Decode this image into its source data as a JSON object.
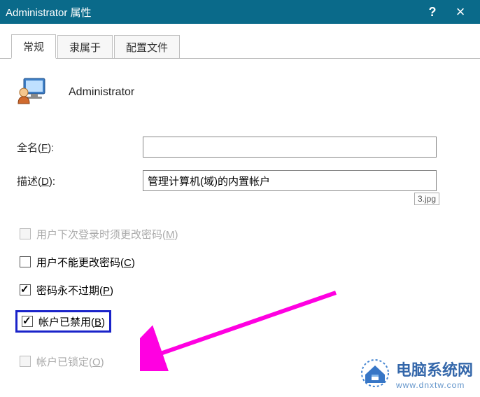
{
  "titlebar": {
    "title": "Administrator 属性"
  },
  "tabs": {
    "t0": "常规",
    "t1": "隶属于",
    "t2": "配置文件"
  },
  "account": {
    "name": "Administrator"
  },
  "labels": {
    "fullname_pre": "全名(",
    "fullname_u": "F",
    "fullname_post": "):",
    "desc_pre": "描述(",
    "desc_u": "D",
    "desc_post": "):"
  },
  "fields": {
    "fullname": "",
    "description": "管理计算机(域)的内置帐户"
  },
  "img_tag": "3.jpg",
  "checkboxes": {
    "mustchange_pre": "用户下次登录时须更改密码(",
    "mustchange_u": "M",
    "mustchange_post": ")",
    "cannotchange_pre": "用户不能更改密码(",
    "cannotchange_u": "C",
    "cannotchange_post": ")",
    "neverexpire_pre": "密码永不过期(",
    "neverexpire_u": "P",
    "neverexpire_post": ")",
    "disabled_pre": "帐户已禁用(",
    "disabled_u": "B",
    "disabled_post": ")",
    "locked_pre": "帐户已锁定(",
    "locked_u": "O",
    "locked_post": ")"
  },
  "watermark": {
    "line1": "电脑系统网",
    "line2": "www.dnxtw.com"
  }
}
